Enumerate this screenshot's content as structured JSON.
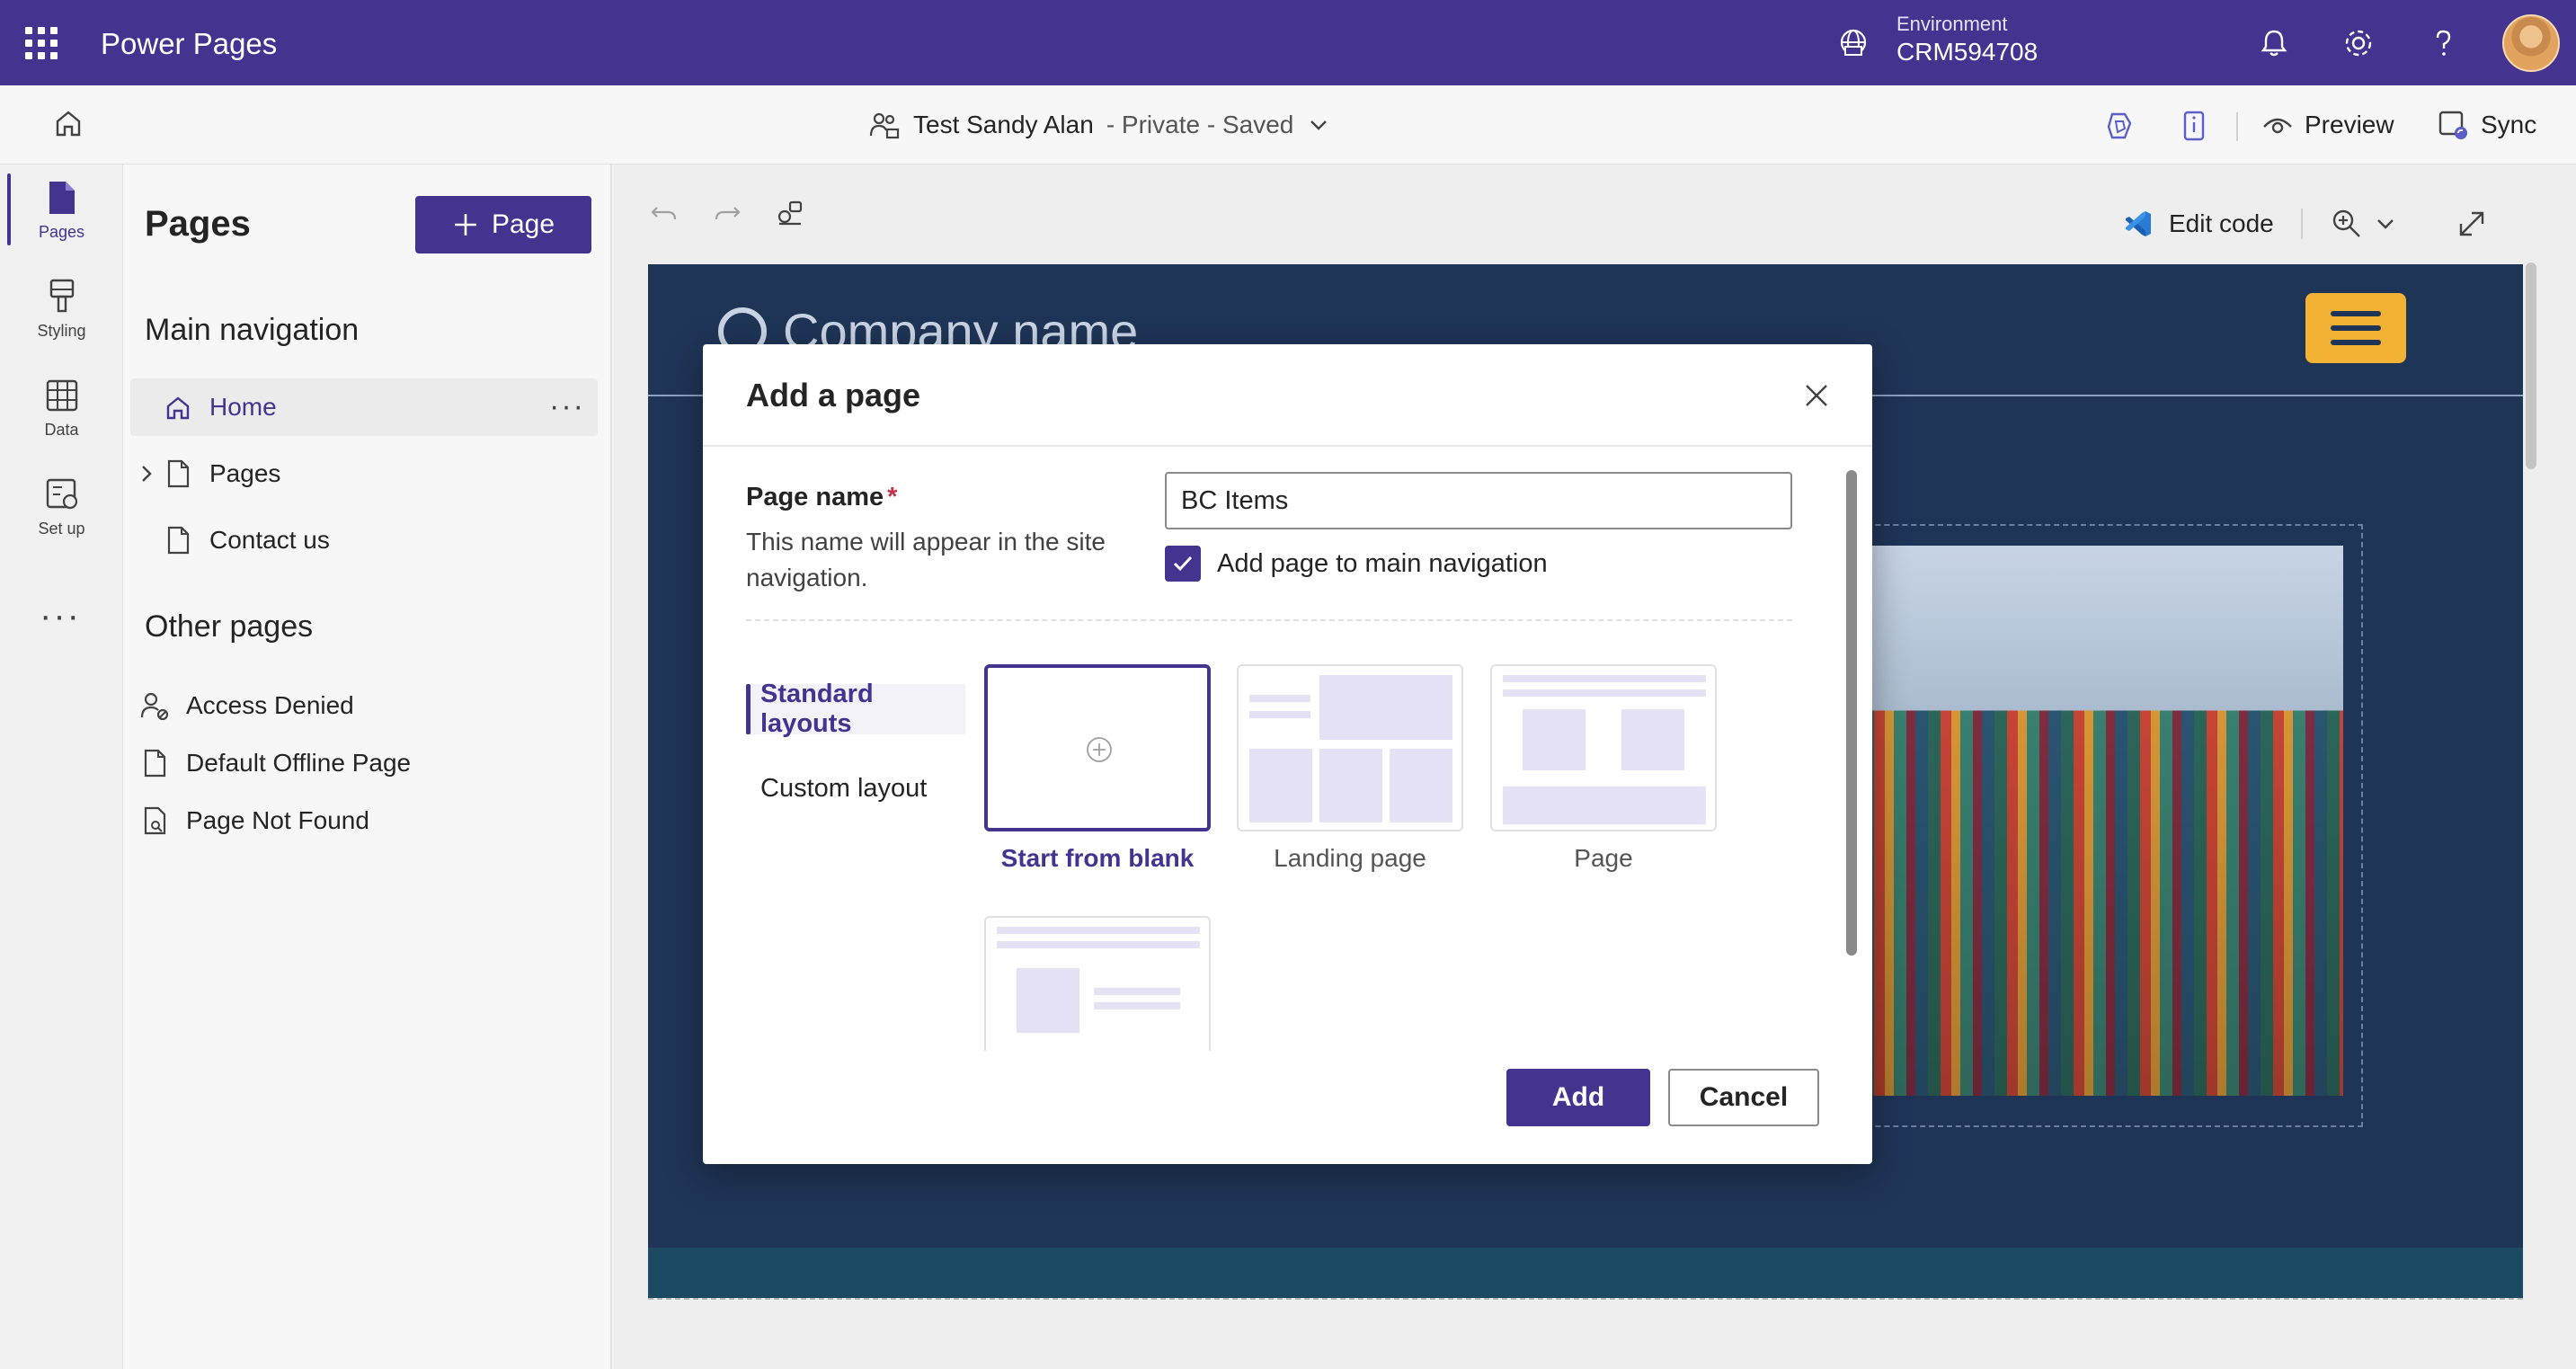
{
  "header": {
    "app_title": "Power Pages",
    "environment_label": "Environment",
    "environment_value": "CRM594708"
  },
  "cmdbar": {
    "site_name": "Test Sandy Alan",
    "site_status": "- Private - Saved",
    "preview_label": "Preview",
    "sync_label": "Sync"
  },
  "rail": {
    "items": [
      {
        "label": "Pages"
      },
      {
        "label": "Styling"
      },
      {
        "label": "Data"
      },
      {
        "label": "Set up"
      }
    ],
    "more": "···"
  },
  "panel": {
    "title": "Pages",
    "add_button": "Page",
    "main_nav_heading": "Main navigation",
    "main_nav_items": [
      {
        "label": "Home"
      },
      {
        "label": "Pages"
      },
      {
        "label": "Contact us"
      }
    ],
    "other_heading": "Other pages",
    "other_items": [
      {
        "label": "Access Denied"
      },
      {
        "label": "Default Offline Page"
      },
      {
        "label": "Page Not Found"
      }
    ]
  },
  "canvas": {
    "edit_code_label": "Edit code",
    "company_name": "Company name"
  },
  "modal": {
    "title": "Add a page",
    "page_name_label": "Page name",
    "required_mark": "*",
    "page_name_help": "This name will appear in the site navigation.",
    "page_name_value": "BC Items",
    "add_to_nav_label": "Add page to main navigation",
    "add_to_nav_checked": true,
    "tabs": [
      {
        "label": "Standard layouts"
      },
      {
        "label": "Custom layout"
      }
    ],
    "layouts": [
      {
        "label": "Start from blank"
      },
      {
        "label": "Landing page"
      },
      {
        "label": "Page"
      }
    ],
    "add_button": "Add",
    "cancel_button": "Cancel"
  },
  "colors": {
    "brand": "#44338f",
    "site_bg": "#1f3557",
    "accent_yellow": "#f2b233"
  }
}
